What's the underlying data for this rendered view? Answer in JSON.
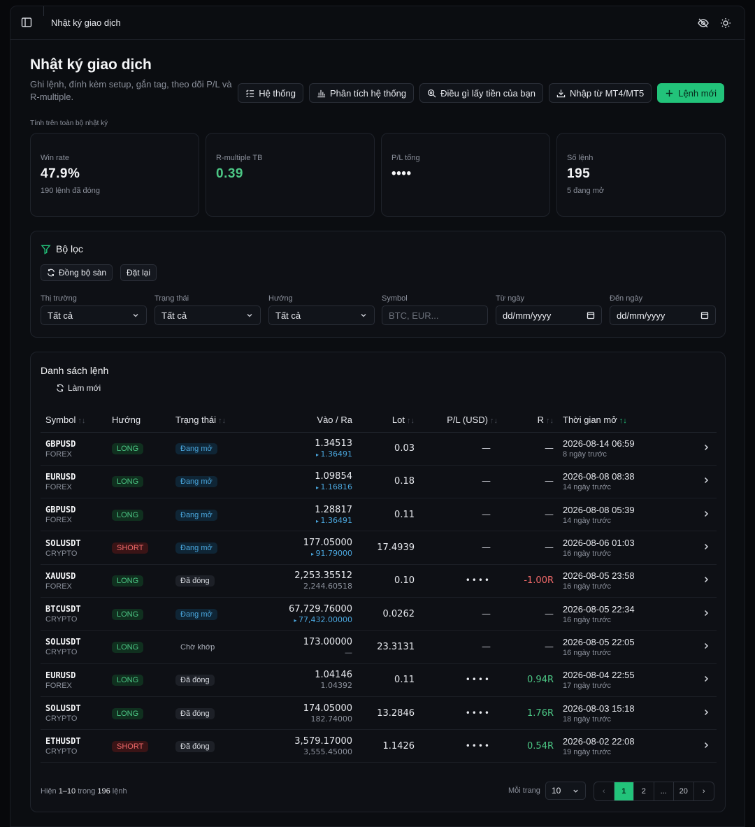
{
  "topbar": {
    "title": "Nhật ký giao dịch"
  },
  "header": {
    "title": "Nhật ký giao dịch",
    "subtitle": "Ghi lệnh, đính kèm setup, gắn tag, theo dõi P/L và R-multiple."
  },
  "actions": {
    "system": "Hệ thống",
    "analysis": "Phân tích hệ thống",
    "what_makes_money": "Điều gì lấy tiền của bạn",
    "import": "Nhập từ MT4/MT5",
    "new_order": "Lệnh mới"
  },
  "scope_note": "Tính trên toàn bộ nhật ký",
  "stats": [
    {
      "label": "Win rate",
      "value": "47.9%",
      "sub": "190 lệnh đã đóng"
    },
    {
      "label": "R-multiple TB",
      "value": "0.39",
      "sub": ""
    },
    {
      "label": "P/L tổng",
      "value": "••••",
      "sub": ""
    },
    {
      "label": "Số lệnh",
      "value": "195",
      "sub": "5 đang mở"
    }
  ],
  "filters": {
    "title": "Bộ lọc",
    "sync_label": "Đồng bộ sàn",
    "reset_label": "Đặt lại",
    "fields": [
      {
        "label": "Thị trường",
        "value": "Tất cả"
      },
      {
        "label": "Trạng thái",
        "value": "Tất cả"
      },
      {
        "label": "Hướng",
        "value": "Tất cả"
      },
      {
        "label": "Symbol",
        "placeholder": "BTC, EUR..."
      },
      {
        "label": "Từ ngày",
        "value": "dd/mm/yyyy"
      },
      {
        "label": "Đến ngày",
        "value": "dd/mm/yyyy"
      }
    ]
  },
  "orders": {
    "title": "Danh sách lệnh",
    "refresh_label": "Làm mới",
    "columns": [
      "Symbol",
      "Hướng",
      "Trạng thái",
      "Vào / Ra",
      "Lot",
      "P/L (USD)",
      "R",
      "Thời gian mở"
    ],
    "rows": [
      {
        "symbol": "GBPUSD",
        "market": "FOREX",
        "side": "LONG",
        "status": "Đang mở",
        "entry": "1.34513",
        "exit": "1.36491",
        "live": true,
        "lot": "0.03",
        "pl": "—",
        "r": "—",
        "time": "2026-08-14 06:59",
        "ago": "8 ngày trước"
      },
      {
        "symbol": "EURUSD",
        "market": "FOREX",
        "side": "LONG",
        "status": "Đang mở",
        "entry": "1.09854",
        "exit": "1.16816",
        "live": true,
        "lot": "0.18",
        "pl": "—",
        "r": "—",
        "time": "2026-08-08 08:38",
        "ago": "14 ngày trước"
      },
      {
        "symbol": "GBPUSD",
        "market": "FOREX",
        "side": "LONG",
        "status": "Đang mở",
        "entry": "1.28817",
        "exit": "1.36491",
        "live": true,
        "lot": "0.11",
        "pl": "—",
        "r": "—",
        "time": "2026-08-08 05:39",
        "ago": "14 ngày trước"
      },
      {
        "symbol": "SOLUSDT",
        "market": "CRYPTO",
        "side": "SHORT",
        "status": "Đang mở",
        "entry": "177.05000",
        "exit": "91.79000",
        "live": true,
        "lot": "17.4939",
        "pl": "—",
        "r": "—",
        "time": "2026-08-06 01:03",
        "ago": "16 ngày trước"
      },
      {
        "symbol": "XAUUSD",
        "market": "FOREX",
        "side": "LONG",
        "status": "Đã đóng",
        "entry": "2,253.35512",
        "exit": "2,244.60518",
        "live": false,
        "lot": "0.10",
        "pl": "••••",
        "r": "-1.00R",
        "time": "2026-08-05 23:58",
        "ago": "16 ngày trước"
      },
      {
        "symbol": "BTCUSDT",
        "market": "CRYPTO",
        "side": "LONG",
        "status": "Đang mở",
        "entry": "67,729.76000",
        "exit": "77,432.00000",
        "live": true,
        "lot": "0.0262",
        "pl": "—",
        "r": "—",
        "time": "2026-08-05 22:34",
        "ago": "16 ngày trước"
      },
      {
        "symbol": "SOLUSDT",
        "market": "CRYPTO",
        "side": "LONG",
        "status": "Chờ khớp",
        "entry": "173.00000",
        "exit": "—",
        "live": false,
        "lot": "23.3131",
        "pl": "—",
        "r": "—",
        "time": "2026-08-05 22:05",
        "ago": "16 ngày trước"
      },
      {
        "symbol": "EURUSD",
        "market": "FOREX",
        "side": "LONG",
        "status": "Đã đóng",
        "entry": "1.04146",
        "exit": "1.04392",
        "live": false,
        "lot": "0.11",
        "pl": "••••",
        "r": "0.94R",
        "time": "2026-08-04 22:55",
        "ago": "17 ngày trước"
      },
      {
        "symbol": "SOLUSDT",
        "market": "CRYPTO",
        "side": "LONG",
        "status": "Đã đóng",
        "entry": "174.05000",
        "exit": "182.74000",
        "live": false,
        "lot": "13.2846",
        "pl": "••••",
        "r": "1.76R",
        "time": "2026-08-03 15:18",
        "ago": "18 ngày trước"
      },
      {
        "symbol": "ETHUSDT",
        "market": "CRYPTO",
        "side": "SHORT",
        "status": "Đã đóng",
        "entry": "3,579.17000",
        "exit": "3,555.45000",
        "live": false,
        "lot": "1.1426",
        "pl": "••••",
        "r": "0.54R",
        "time": "2026-08-02 22:08",
        "ago": "19 ngày trước"
      }
    ]
  },
  "footer": {
    "info_prefix": "Hiện",
    "range": "1–10",
    "info_mid": "trong",
    "total": "196",
    "info_suffix": "lệnh",
    "per_page_label": "Mỗi trang",
    "per_page_value": "10",
    "pages": [
      "1",
      "2",
      "...",
      "20"
    ],
    "current_page": "1"
  },
  "colors": {
    "accent": "#22c37a",
    "long": "#4cc785",
    "short": "#f26a6a",
    "open": "#4aa6dd"
  }
}
